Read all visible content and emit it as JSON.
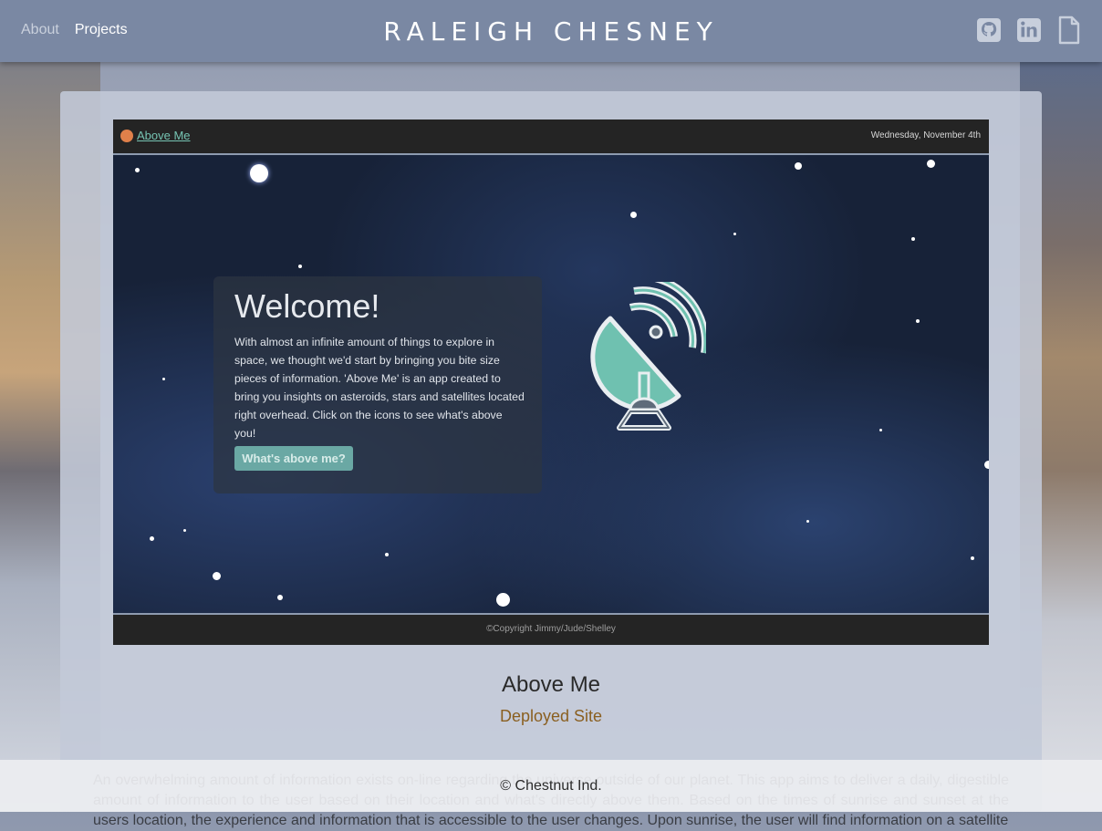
{
  "nav": {
    "items": [
      {
        "label": "About"
      },
      {
        "label": "Projects"
      }
    ],
    "brand": "RALEIGH CHESNEY",
    "icons": [
      "github-icon",
      "linkedin-icon",
      "document-icon"
    ]
  },
  "project": {
    "screenshot": {
      "app_link": "Above Me",
      "date": "Wednesday, November 4th",
      "welcome_title": "Welcome!",
      "welcome_text": "With almost an infinite amount of things to explore in space, we thought we'd start by bringing you bite size pieces of information. 'Above Me' is an app created to bring you insights on asteroids, stars and satellites located right overhead. Click on the icons to see what's above you!",
      "cta_label": "What's above me?",
      "copyright": "©Copyright Jimmy/Jude/Shelley",
      "illustration": "satellite-dish-icon"
    },
    "title": "Above Me",
    "link_label": "Deployed Site",
    "description": "An overwhelming amount of information exists on-line regarding the universe outside of our planet. This app aims to deliver a daily, digestible amount of information to the user based on their location and what's directly above them. Based on the times of sunrise and sunset at the users location, the experience and information that is accessible to the user changes. Upon sunrise, the user will find information on a satellite"
  },
  "footer": {
    "text": "© Chestnut Ind."
  },
  "colors": {
    "header": "#7a88a3",
    "accent_link": "#8a5f20",
    "teal": "#76c4b3"
  }
}
